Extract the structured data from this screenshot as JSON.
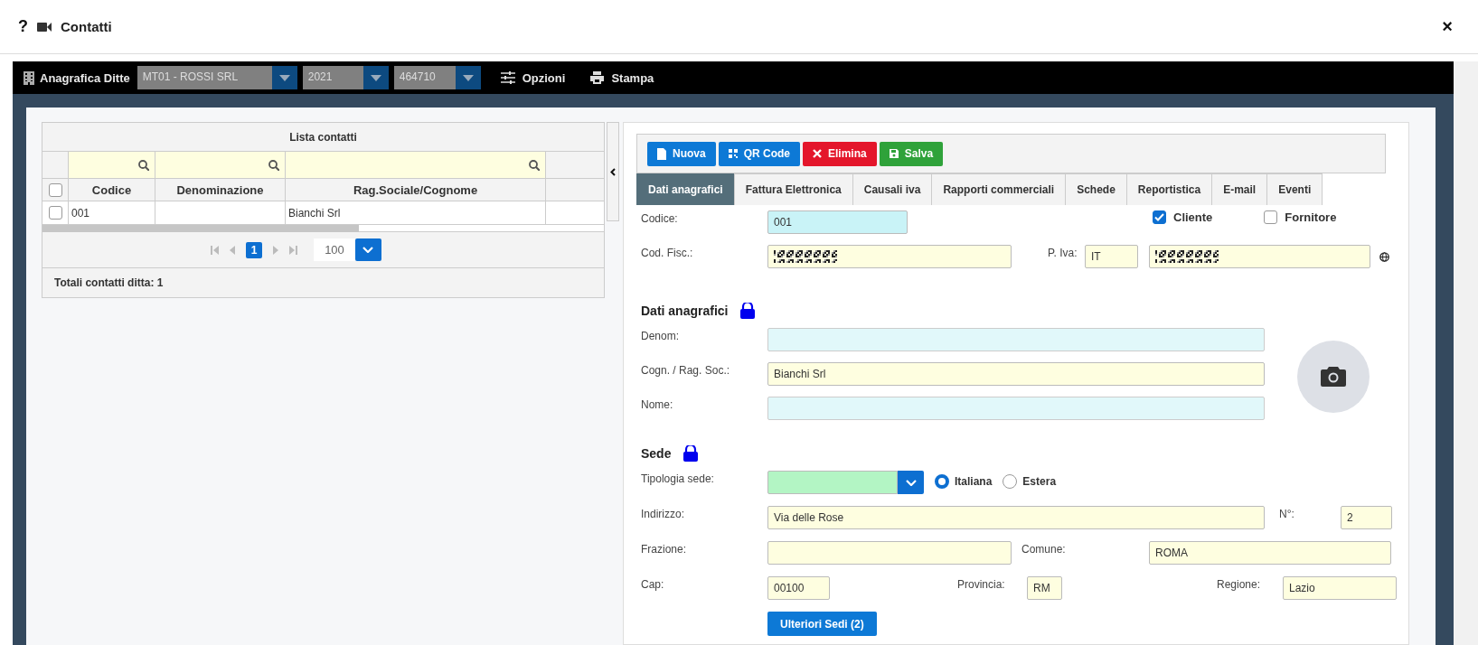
{
  "window": {
    "help": "?",
    "title": "Contatti",
    "close": "×"
  },
  "toolbar": {
    "title": "Anagrafica Ditte",
    "selects": [
      {
        "value": "MT01 - ROSSI SRL"
      },
      {
        "value": "2021"
      },
      {
        "value": "464710"
      }
    ],
    "actions": [
      {
        "label": "Opzioni",
        "kind": "options"
      },
      {
        "label": "Stampa",
        "kind": "print"
      }
    ]
  },
  "contact_list": {
    "title": "Lista contatti",
    "columns": [
      "Codice",
      "Denominazione",
      "Rag.Sociale/Cognome"
    ],
    "all_checked": false,
    "rows": [
      {
        "checked": false,
        "codice": "001",
        "rag_sociale": "Bianchi Srl"
      }
    ],
    "pager": {
      "pages": [
        {
          "label": "1",
          "selected": true
        }
      ],
      "page_size": "100"
    },
    "total": "Totali contatti ditta: 1"
  },
  "detail": {
    "buttons": [
      {
        "label": "Nuova",
        "kind": "new"
      },
      {
        "label": "QR Code",
        "kind": "qr"
      },
      {
        "label": "Elimina",
        "kind": "delete"
      },
      {
        "label": "Salva",
        "kind": "save"
      }
    ],
    "tabs": [
      {
        "label": "Dati anagrafici",
        "selected": true
      },
      {
        "label": "Fattura Elettronica",
        "selected": false
      },
      {
        "label": "Causali iva",
        "selected": false
      },
      {
        "label": "Rapporti commerciali",
        "selected": false
      },
      {
        "label": "Schede",
        "selected": false
      },
      {
        "label": "Reportistica",
        "selected": false
      },
      {
        "label": "E-mail",
        "selected": false
      },
      {
        "label": "Eventi",
        "selected": false
      }
    ],
    "codice": {
      "label": "Codice:",
      "value": "001"
    },
    "cliente": {
      "label": "Cliente",
      "checked": true
    },
    "fornitore": {
      "label": "Fornitore",
      "checked": false
    },
    "cod_fisc": {
      "label": "Cod. Fisc.:",
      "redacted": true
    },
    "p_iva": {
      "label": "P. Iva:",
      "prefix": "IT",
      "redacted": true
    },
    "section_anagrafici": {
      "title": "Dati anagrafici",
      "locked": true
    },
    "denom": {
      "label": "Denom:"
    },
    "cognome": {
      "label": "Cogn. / Rag. Soc.:",
      "value": "Bianchi Srl"
    },
    "nome": {
      "label": "Nome:"
    },
    "section_sede": {
      "title": "Sede",
      "locked": true
    },
    "tipologia": {
      "label": "Tipologia sede:"
    },
    "location": [
      {
        "label": "Italiana",
        "selected": true
      },
      {
        "label": "Estera",
        "selected": false
      }
    ],
    "indirizzo": {
      "label": "Indirizzo:",
      "value": "Via delle Rose"
    },
    "numero": {
      "label": "N°:",
      "value": "2"
    },
    "frazione": {
      "label": "Frazione:"
    },
    "comune": {
      "label": "Comune:",
      "value": "ROMA"
    },
    "cap": {
      "label": "Cap:",
      "value": "00100"
    },
    "provincia": {
      "label": "Provincia:",
      "value": "RM"
    },
    "regione": {
      "label": "Regione:",
      "value": "Lazio"
    },
    "more_button": "Ulteriori Sedi (2)"
  }
}
